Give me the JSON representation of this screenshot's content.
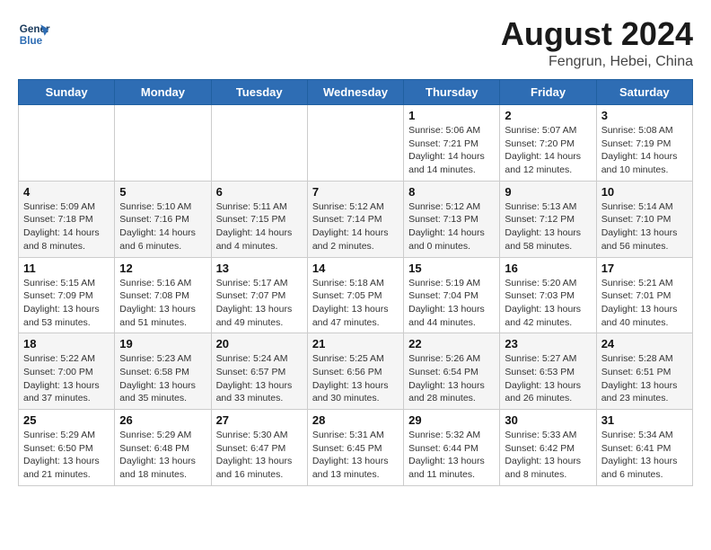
{
  "header": {
    "logo_line1": "General",
    "logo_line2": "Blue",
    "month": "August 2024",
    "location": "Fengrun, Hebei, China"
  },
  "weekdays": [
    "Sunday",
    "Monday",
    "Tuesday",
    "Wednesday",
    "Thursday",
    "Friday",
    "Saturday"
  ],
  "weeks": [
    [
      {
        "day": "",
        "info": ""
      },
      {
        "day": "",
        "info": ""
      },
      {
        "day": "",
        "info": ""
      },
      {
        "day": "",
        "info": ""
      },
      {
        "day": "1",
        "info": "Sunrise: 5:06 AM\nSunset: 7:21 PM\nDaylight: 14 hours\nand 14 minutes."
      },
      {
        "day": "2",
        "info": "Sunrise: 5:07 AM\nSunset: 7:20 PM\nDaylight: 14 hours\nand 12 minutes."
      },
      {
        "day": "3",
        "info": "Sunrise: 5:08 AM\nSunset: 7:19 PM\nDaylight: 14 hours\nand 10 minutes."
      }
    ],
    [
      {
        "day": "4",
        "info": "Sunrise: 5:09 AM\nSunset: 7:18 PM\nDaylight: 14 hours\nand 8 minutes."
      },
      {
        "day": "5",
        "info": "Sunrise: 5:10 AM\nSunset: 7:16 PM\nDaylight: 14 hours\nand 6 minutes."
      },
      {
        "day": "6",
        "info": "Sunrise: 5:11 AM\nSunset: 7:15 PM\nDaylight: 14 hours\nand 4 minutes."
      },
      {
        "day": "7",
        "info": "Sunrise: 5:12 AM\nSunset: 7:14 PM\nDaylight: 14 hours\nand 2 minutes."
      },
      {
        "day": "8",
        "info": "Sunrise: 5:12 AM\nSunset: 7:13 PM\nDaylight: 14 hours\nand 0 minutes."
      },
      {
        "day": "9",
        "info": "Sunrise: 5:13 AM\nSunset: 7:12 PM\nDaylight: 13 hours\nand 58 minutes."
      },
      {
        "day": "10",
        "info": "Sunrise: 5:14 AM\nSunset: 7:10 PM\nDaylight: 13 hours\nand 56 minutes."
      }
    ],
    [
      {
        "day": "11",
        "info": "Sunrise: 5:15 AM\nSunset: 7:09 PM\nDaylight: 13 hours\nand 53 minutes."
      },
      {
        "day": "12",
        "info": "Sunrise: 5:16 AM\nSunset: 7:08 PM\nDaylight: 13 hours\nand 51 minutes."
      },
      {
        "day": "13",
        "info": "Sunrise: 5:17 AM\nSunset: 7:07 PM\nDaylight: 13 hours\nand 49 minutes."
      },
      {
        "day": "14",
        "info": "Sunrise: 5:18 AM\nSunset: 7:05 PM\nDaylight: 13 hours\nand 47 minutes."
      },
      {
        "day": "15",
        "info": "Sunrise: 5:19 AM\nSunset: 7:04 PM\nDaylight: 13 hours\nand 44 minutes."
      },
      {
        "day": "16",
        "info": "Sunrise: 5:20 AM\nSunset: 7:03 PM\nDaylight: 13 hours\nand 42 minutes."
      },
      {
        "day": "17",
        "info": "Sunrise: 5:21 AM\nSunset: 7:01 PM\nDaylight: 13 hours\nand 40 minutes."
      }
    ],
    [
      {
        "day": "18",
        "info": "Sunrise: 5:22 AM\nSunset: 7:00 PM\nDaylight: 13 hours\nand 37 minutes."
      },
      {
        "day": "19",
        "info": "Sunrise: 5:23 AM\nSunset: 6:58 PM\nDaylight: 13 hours\nand 35 minutes."
      },
      {
        "day": "20",
        "info": "Sunrise: 5:24 AM\nSunset: 6:57 PM\nDaylight: 13 hours\nand 33 minutes."
      },
      {
        "day": "21",
        "info": "Sunrise: 5:25 AM\nSunset: 6:56 PM\nDaylight: 13 hours\nand 30 minutes."
      },
      {
        "day": "22",
        "info": "Sunrise: 5:26 AM\nSunset: 6:54 PM\nDaylight: 13 hours\nand 28 minutes."
      },
      {
        "day": "23",
        "info": "Sunrise: 5:27 AM\nSunset: 6:53 PM\nDaylight: 13 hours\nand 26 minutes."
      },
      {
        "day": "24",
        "info": "Sunrise: 5:28 AM\nSunset: 6:51 PM\nDaylight: 13 hours\nand 23 minutes."
      }
    ],
    [
      {
        "day": "25",
        "info": "Sunrise: 5:29 AM\nSunset: 6:50 PM\nDaylight: 13 hours\nand 21 minutes."
      },
      {
        "day": "26",
        "info": "Sunrise: 5:29 AM\nSunset: 6:48 PM\nDaylight: 13 hours\nand 18 minutes."
      },
      {
        "day": "27",
        "info": "Sunrise: 5:30 AM\nSunset: 6:47 PM\nDaylight: 13 hours\nand 16 minutes."
      },
      {
        "day": "28",
        "info": "Sunrise: 5:31 AM\nSunset: 6:45 PM\nDaylight: 13 hours\nand 13 minutes."
      },
      {
        "day": "29",
        "info": "Sunrise: 5:32 AM\nSunset: 6:44 PM\nDaylight: 13 hours\nand 11 minutes."
      },
      {
        "day": "30",
        "info": "Sunrise: 5:33 AM\nSunset: 6:42 PM\nDaylight: 13 hours\nand 8 minutes."
      },
      {
        "day": "31",
        "info": "Sunrise: 5:34 AM\nSunset: 6:41 PM\nDaylight: 13 hours\nand 6 minutes."
      }
    ]
  ]
}
